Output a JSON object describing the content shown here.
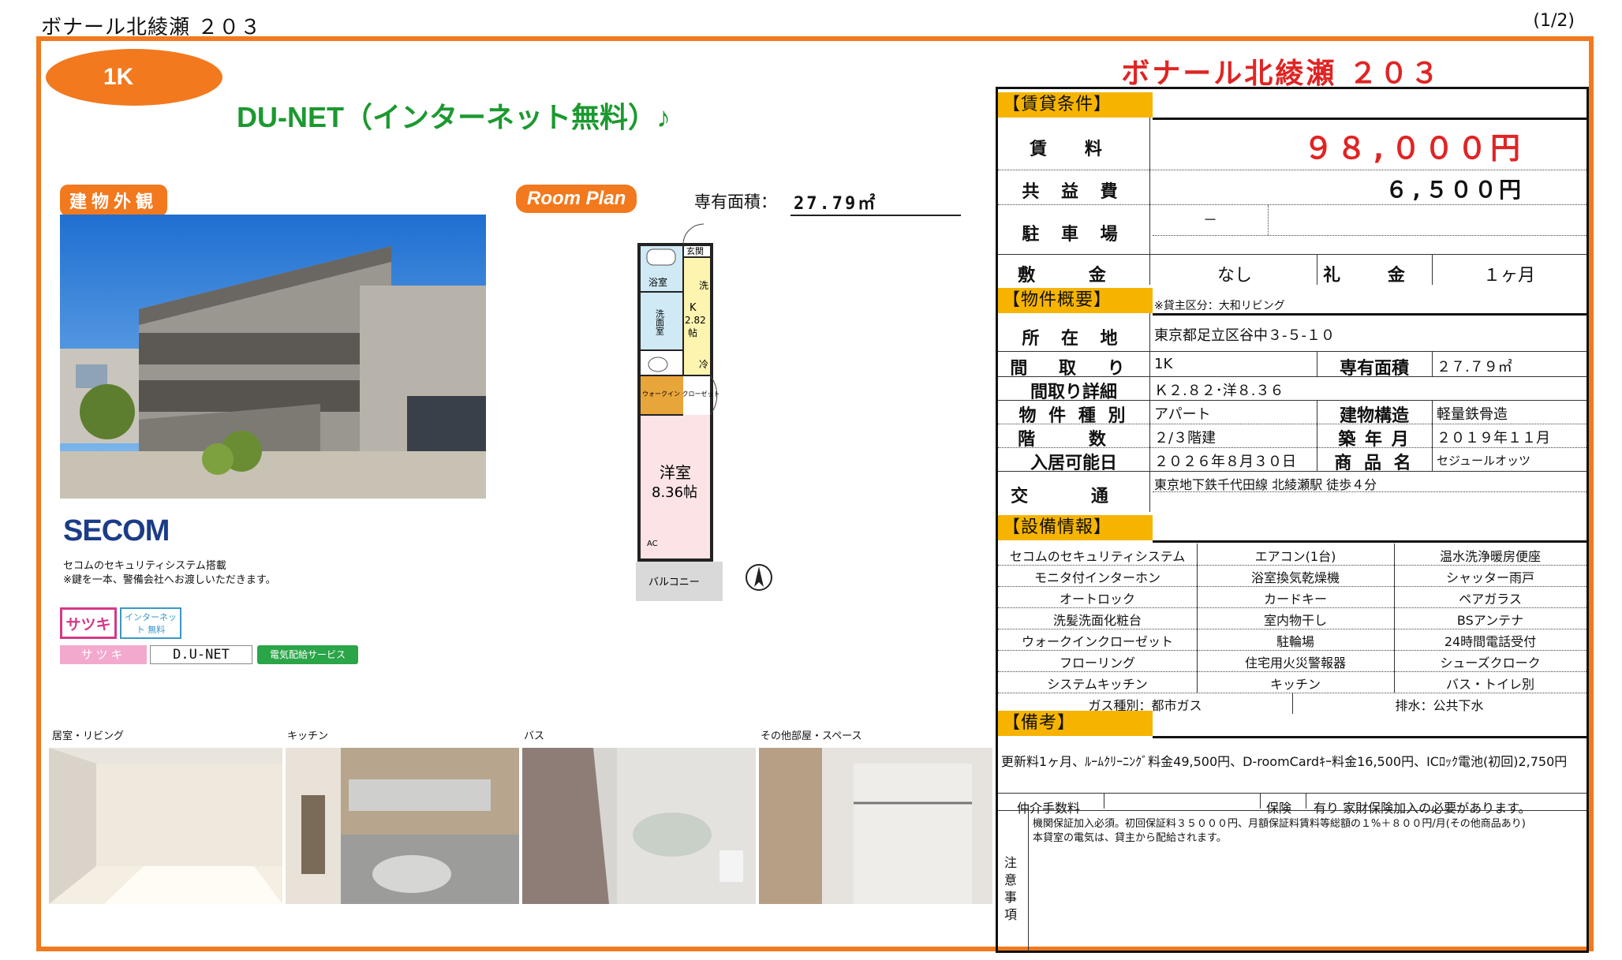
{
  "header": {
    "title": "ボナール北綾瀬 ２０３",
    "page": "(1/2)"
  },
  "left": {
    "room_type": "1K",
    "headline": "DU-NET（インターネット無料）♪",
    "exterior_tag": "建物外観",
    "roomplan_tag": "Room Plan",
    "area_label": "専有面積：",
    "area_value": "27.79㎡",
    "secom_logo": "SECOM",
    "secom_note1": "セコムのセキュリティシステム搭載",
    "secom_note2": "※鍵を一本、警備会社へお渡しいただきます。",
    "badge_satsuki": "サツキ",
    "badge_inet": "インターネット 無料",
    "band_satsuki": "サツキ",
    "band_dunet": "D.U-NET",
    "band_denki": "電気配給サービス",
    "floorplan": {
      "genkan": "玄関",
      "bath": "浴室",
      "wash": "洗",
      "senmen": "洗面室",
      "k": "K",
      "k_size": "2.82",
      "k_unit": "帖",
      "rei": "冷",
      "closet": "ウォークイン クローゼット",
      "western": "洋室",
      "western_size": "8.36帖",
      "ac": "AC",
      "balcony": "バルコニー"
    },
    "thumbnails": [
      {
        "caption": "居室・リビング"
      },
      {
        "caption": "キッチン"
      },
      {
        "caption": "バス"
      },
      {
        "caption": "その他部屋・スペース"
      }
    ]
  },
  "right": {
    "title": "ボナール北綾瀬 ２０３",
    "sec_rent": "【賃貸条件】",
    "rent_label": "賃 料",
    "rent_value": "９８,０００円",
    "common_label": "共 益 費",
    "common_value": "６,５００円",
    "parking_label": "駐 車 場",
    "parking_value": "－",
    "deposit_label": "敷 金",
    "deposit_value": "なし",
    "keymoney_label": "礼 金",
    "keymoney_value": "１ヶ月",
    "sec_overview": "【物件概要】",
    "overview_note": "※貸主区分：大和リビング",
    "address_label": "所 在 地",
    "address_value": "東京都足立区谷中３-５-１０",
    "layout_label": "間 取 り",
    "layout_value": "1K",
    "area_label": "専有面積",
    "area_value": "２７.７９㎡",
    "layout_detail_label": "間取り詳細",
    "layout_detail_value": "Ｋ２.８２･洋８.３６",
    "type_label": "物 件 種 別",
    "type_value": "アパート",
    "structure_label": "建物構造",
    "structure_value": "軽量鉄骨造",
    "floors_label": "階 数",
    "floors_value": "２/３階建",
    "built_label": "築 年 月",
    "built_value": "２０１９年１１月",
    "movein_label": "入居可能日",
    "movein_value": "２０２６年８月３０日",
    "product_label": "商 品 名",
    "product_value": "セジュールオッツ",
    "access_label": "交 通",
    "access_value": "東京地下鉄千代田線 北綾瀬駅 徒歩４分",
    "sec_equip": "【設備情報】",
    "equipment": [
      [
        "セコムのセキュリティシステム",
        "エアコン(1台)",
        "温水洗浄暖房便座"
      ],
      [
        "モニタ付インターホン",
        "浴室換気乾燥機",
        "シャッター雨戸"
      ],
      [
        "オートロック",
        "カードキー",
        "ペアガラス"
      ],
      [
        "洗髪洗面化粧台",
        "室内物干し",
        "BSアンテナ"
      ],
      [
        "ウォークインクローゼット",
        "駐輪場",
        "24時間電話受付"
      ],
      [
        "フローリング",
        "住宅用火災警報器",
        "シューズクローク"
      ],
      [
        "システムキッチン",
        "キッチン",
        "バス・トイレ別"
      ]
    ],
    "gas": "ガス種別：都市ガス",
    "drain": "排水：公共下水",
    "sec_remarks": "【備考】",
    "remarks_text": "更新料1ヶ月、ﾙｰﾑｸﾘｰﾆﾝｸﾞ料金49,500円、D-roomCardｷｰ料金16,500円、ICﾛｯｸ電池(初回)2,750円",
    "broker_label": "仲介手数料",
    "insurance_label": "保険",
    "insurance_value": "有り 家財保険加入の必要があります。",
    "notes_label": "注意事項",
    "notes_line1": "機関保証加入必須。初回保証料３５０００円、月額保証料賃料等総額の１%＋８００円/月(その他商品あり)",
    "notes_line2": "本貸室の電気は、貸主から配給されます。"
  },
  "colors": {
    "frame": "#f2791e",
    "section_header": "#f6b400",
    "title_red": "#e02424",
    "headline_green": "#1c9930"
  }
}
